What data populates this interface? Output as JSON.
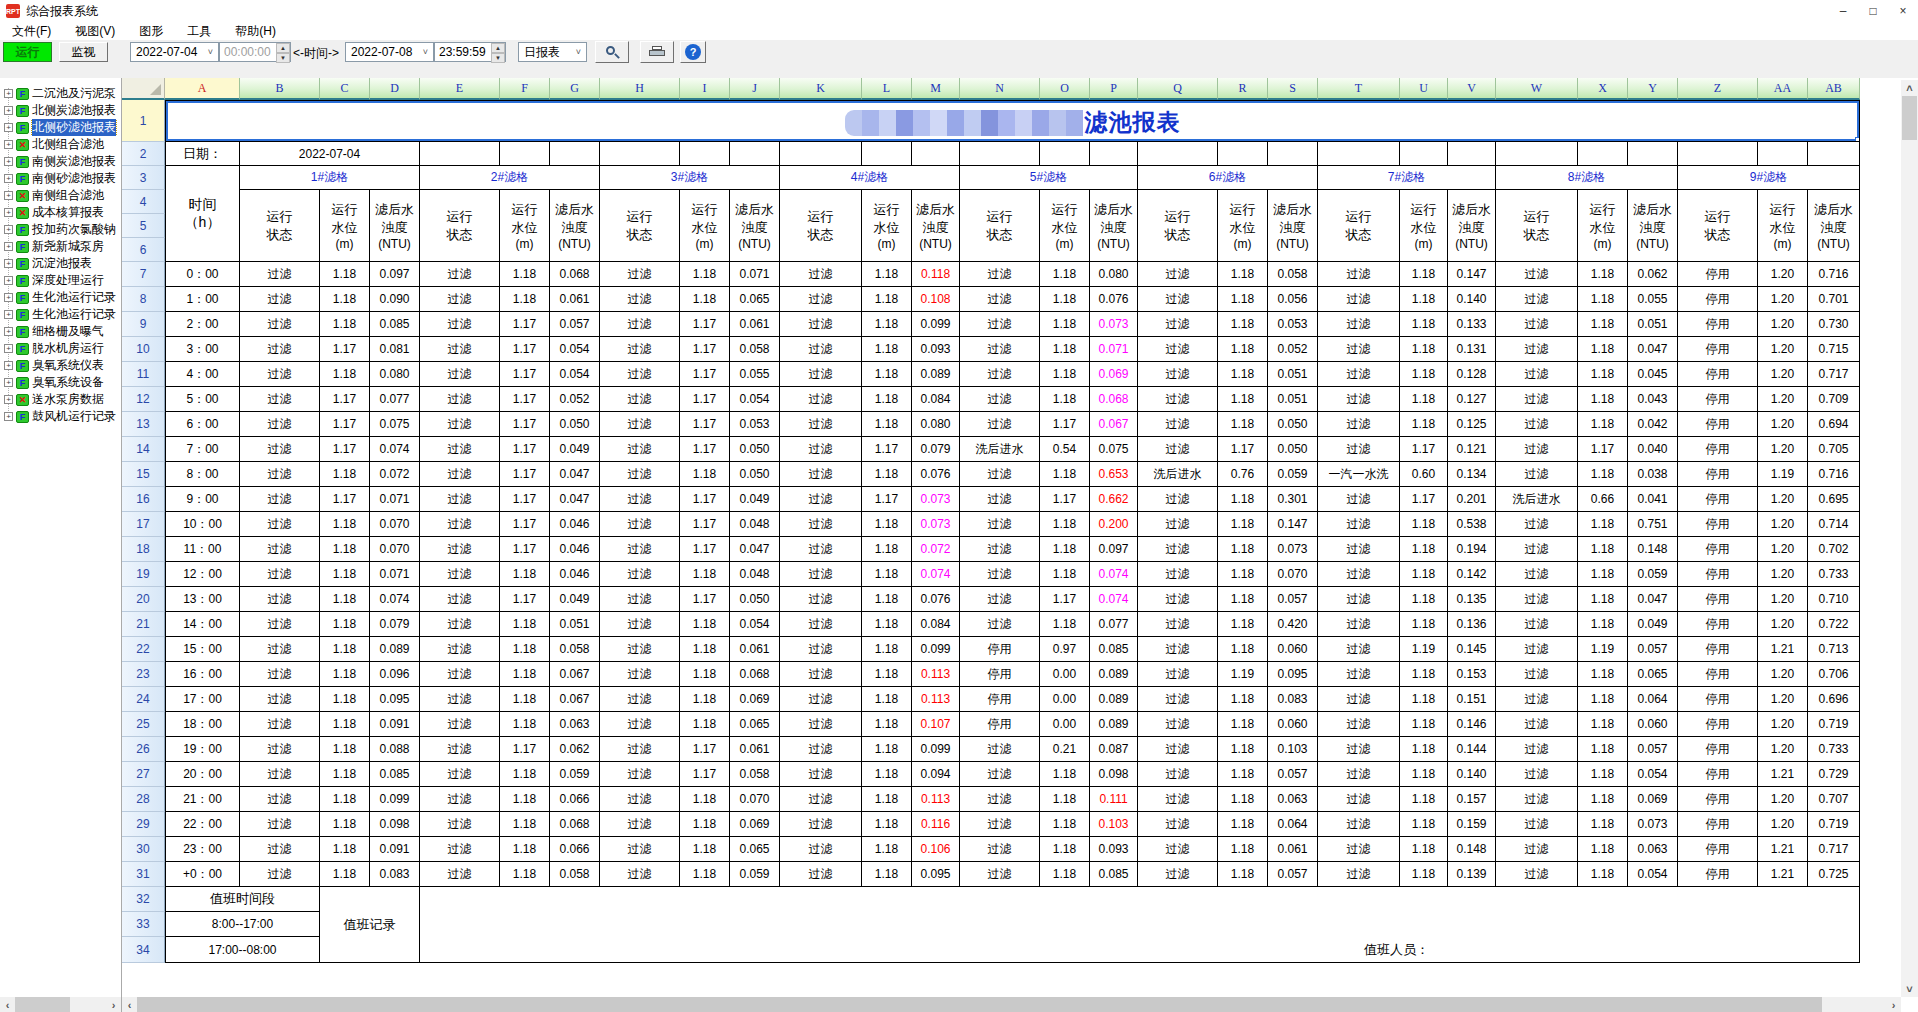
{
  "window": {
    "title": "综合报表系统",
    "minimize": "–",
    "maximize": "□",
    "close": "×"
  },
  "menu": [
    "文件(F)",
    "视图(V)",
    "图形",
    "工具",
    "帮助(H)"
  ],
  "toolbar": {
    "run": "运行",
    "monitor": "监视",
    "date_from": "2022-07-04",
    "time_from": "00:00:00",
    "time_label": "<-时间->",
    "date_to": "2022-07-08",
    "time_to": "23:59:59",
    "report_type": "日报表"
  },
  "sidebar": {
    "items": [
      {
        "label": "二沉池及污泥泵",
        "icon": "f"
      },
      {
        "label": "北侧炭滤池报表",
        "icon": "f"
      },
      {
        "label": "北侧砂滤池报表",
        "icon": "f",
        "selected": true
      },
      {
        "label": "北侧组合滤池",
        "icon": "x"
      },
      {
        "label": "南侧炭滤池报表",
        "icon": "f"
      },
      {
        "label": "南侧砂滤池报表",
        "icon": "f"
      },
      {
        "label": "南侧组合滤池",
        "icon": "x"
      },
      {
        "label": "成本核算报表",
        "icon": "x"
      },
      {
        "label": "投加药次氯酸钠",
        "icon": "f"
      },
      {
        "label": "新尧新城泵房",
        "icon": "f"
      },
      {
        "label": "沉淀池报表",
        "icon": "f"
      },
      {
        "label": "深度处理运行",
        "icon": "f"
      },
      {
        "label": "生化池运行记录",
        "icon": "f"
      },
      {
        "label": "生化池运行记录",
        "icon": "f"
      },
      {
        "label": "细格栅及曝气",
        "icon": "f"
      },
      {
        "label": "脱水机房运行",
        "icon": "f"
      },
      {
        "label": "臭氧系统仪表",
        "icon": "f"
      },
      {
        "label": "臭氧系统设备",
        "icon": "f"
      },
      {
        "label": "送水泵房数据",
        "icon": "x"
      },
      {
        "label": "鼓风机运行记录",
        "icon": "f"
      }
    ]
  },
  "sheet": {
    "columns": [
      "A",
      "B",
      "C",
      "D",
      "E",
      "F",
      "G",
      "H",
      "I",
      "J",
      "K",
      "L",
      "M",
      "N",
      "O",
      "P",
      "Q",
      "R",
      "S",
      "T",
      "U",
      "V",
      "W",
      "X",
      "Y",
      "Z",
      "AA",
      "AB"
    ],
    "title": {
      "censored_colors": [
        "#bcc8f0",
        "#a8b6ec",
        "#c8d2f4",
        "#8a9ae2",
        "#b4c0f0",
        "#d0d8f6",
        "#98a8e8",
        "#c0ccf2",
        "#8494dd",
        "#aab6ef",
        "#c8d0f4",
        "#9aa8e8",
        "#b8c4ee",
        "#a2b0ea"
      ],
      "visible_text": "滤池报表"
    },
    "date_label": "日期：",
    "date_value": "2022-07-04",
    "groups": [
      "1#滤格",
      "2#滤格",
      "3#滤格",
      "4#滤格",
      "5#滤格",
      "6#滤格",
      "7#滤格",
      "8#滤格",
      "9#滤格"
    ],
    "subheaders": {
      "time": "时间",
      "time_unit": "（h）",
      "run": "运行",
      "status": "状态",
      "level": "水位",
      "level_unit": "(m)",
      "filtered": "滤后水",
      "turbidity": "浊度",
      "turbidity_unit": "(NTU)"
    },
    "value_colors": {
      "r": "#ff0000",
      "m": "#ff00ff"
    },
    "rows": [
      {
        "row": 7,
        "time": "0：00",
        "cells": [
          "过滤",
          "1.18",
          "0.097",
          "过滤",
          "1.18",
          "0.068",
          "过滤",
          "1.18",
          "0.071",
          "过滤",
          "1.18",
          "0.118|r",
          "过滤",
          "1.18",
          "0.080",
          "过滤",
          "1.18",
          "0.058",
          "过滤",
          "1.18",
          "0.147",
          "过滤",
          "1.18",
          "0.062",
          "停用",
          "1.20",
          "0.716"
        ]
      },
      {
        "row": 8,
        "time": "1：00",
        "cells": [
          "过滤",
          "1.18",
          "0.090",
          "过滤",
          "1.18",
          "0.061",
          "过滤",
          "1.18",
          "0.065",
          "过滤",
          "1.18",
          "0.108|r",
          "过滤",
          "1.18",
          "0.076",
          "过滤",
          "1.18",
          "0.056",
          "过滤",
          "1.18",
          "0.140",
          "过滤",
          "1.18",
          "0.055",
          "停用",
          "1.20",
          "0.701"
        ]
      },
      {
        "row": 9,
        "time": "2：00",
        "cells": [
          "过滤",
          "1.18",
          "0.085",
          "过滤",
          "1.17",
          "0.057",
          "过滤",
          "1.17",
          "0.061",
          "过滤",
          "1.18",
          "0.099",
          "过滤",
          "1.18",
          "0.073|m",
          "过滤",
          "1.18",
          "0.053",
          "过滤",
          "1.18",
          "0.133",
          "过滤",
          "1.18",
          "0.051",
          "停用",
          "1.20",
          "0.730"
        ]
      },
      {
        "row": 10,
        "time": "3：00",
        "cells": [
          "过滤",
          "1.17",
          "0.081",
          "过滤",
          "1.17",
          "0.054",
          "过滤",
          "1.17",
          "0.058",
          "过滤",
          "1.18",
          "0.093",
          "过滤",
          "1.18",
          "0.071|m",
          "过滤",
          "1.18",
          "0.052",
          "过滤",
          "1.18",
          "0.131",
          "过滤",
          "1.18",
          "0.047",
          "停用",
          "1.20",
          "0.715"
        ]
      },
      {
        "row": 11,
        "time": "4：00",
        "cells": [
          "过滤",
          "1.18",
          "0.080",
          "过滤",
          "1.17",
          "0.054",
          "过滤",
          "1.17",
          "0.055",
          "过滤",
          "1.18",
          "0.089",
          "过滤",
          "1.18",
          "0.069|m",
          "过滤",
          "1.18",
          "0.051",
          "过滤",
          "1.18",
          "0.128",
          "过滤",
          "1.18",
          "0.045",
          "停用",
          "1.20",
          "0.717"
        ]
      },
      {
        "row": 12,
        "time": "5：00",
        "cells": [
          "过滤",
          "1.17",
          "0.077",
          "过滤",
          "1.17",
          "0.052",
          "过滤",
          "1.17",
          "0.054",
          "过滤",
          "1.18",
          "0.084",
          "过滤",
          "1.18",
          "0.068|m",
          "过滤",
          "1.18",
          "0.051",
          "过滤",
          "1.18",
          "0.127",
          "过滤",
          "1.18",
          "0.043",
          "停用",
          "1.20",
          "0.709"
        ]
      },
      {
        "row": 13,
        "time": "6：00",
        "cells": [
          "过滤",
          "1.17",
          "0.075",
          "过滤",
          "1.17",
          "0.050",
          "过滤",
          "1.17",
          "0.053",
          "过滤",
          "1.18",
          "0.080",
          "过滤",
          "1.17",
          "0.067|m",
          "过滤",
          "1.18",
          "0.050",
          "过滤",
          "1.18",
          "0.125",
          "过滤",
          "1.18",
          "0.042",
          "停用",
          "1.20",
          "0.694"
        ]
      },
      {
        "row": 14,
        "time": "7：00",
        "cells": [
          "过滤",
          "1.17",
          "0.074",
          "过滤",
          "1.17",
          "0.049",
          "过滤",
          "1.17",
          "0.050",
          "过滤",
          "1.17",
          "0.079",
          "洗后进水",
          "0.54",
          "0.075",
          "过滤",
          "1.17",
          "0.050",
          "过滤",
          "1.17",
          "0.121",
          "过滤",
          "1.17",
          "0.040",
          "停用",
          "1.20",
          "0.705"
        ]
      },
      {
        "row": 15,
        "time": "8：00",
        "cells": [
          "过滤",
          "1.18",
          "0.072",
          "过滤",
          "1.17",
          "0.047",
          "过滤",
          "1.18",
          "0.050",
          "过滤",
          "1.18",
          "0.076",
          "过滤",
          "1.18",
          "0.653|r",
          "洗后进水",
          "0.76",
          "0.059",
          "一汽一水洗",
          "0.60",
          "0.134",
          "过滤",
          "1.18",
          "0.038",
          "停用",
          "1.19",
          "0.716"
        ]
      },
      {
        "row": 16,
        "time": "9：00",
        "cells": [
          "过滤",
          "1.17",
          "0.071",
          "过滤",
          "1.17",
          "0.047",
          "过滤",
          "1.17",
          "0.049",
          "过滤",
          "1.17",
          "0.073|m",
          "过滤",
          "1.17",
          "0.662|r",
          "过滤",
          "1.18",
          "0.301",
          "过滤",
          "1.17",
          "0.201",
          "洗后进水",
          "0.66",
          "0.041",
          "停用",
          "1.20",
          "0.695"
        ]
      },
      {
        "row": 17,
        "time": "10：00",
        "cells": [
          "过滤",
          "1.18",
          "0.070",
          "过滤",
          "1.17",
          "0.046",
          "过滤",
          "1.17",
          "0.048",
          "过滤",
          "1.18",
          "0.073|m",
          "过滤",
          "1.18",
          "0.200|r",
          "过滤",
          "1.18",
          "0.147",
          "过滤",
          "1.18",
          "0.538",
          "过滤",
          "1.18",
          "0.751",
          "停用",
          "1.20",
          "0.714"
        ]
      },
      {
        "row": 18,
        "time": "11：00",
        "cells": [
          "过滤",
          "1.18",
          "0.070",
          "过滤",
          "1.17",
          "0.046",
          "过滤",
          "1.17",
          "0.047",
          "过滤",
          "1.18",
          "0.072|m",
          "过滤",
          "1.18",
          "0.097",
          "过滤",
          "1.18",
          "0.073",
          "过滤",
          "1.18",
          "0.194",
          "过滤",
          "1.18",
          "0.148",
          "停用",
          "1.20",
          "0.702"
        ]
      },
      {
        "row": 19,
        "time": "12：00",
        "cells": [
          "过滤",
          "1.18",
          "0.071",
          "过滤",
          "1.18",
          "0.046",
          "过滤",
          "1.18",
          "0.048",
          "过滤",
          "1.18",
          "0.074|m",
          "过滤",
          "1.18",
          "0.074|m",
          "过滤",
          "1.18",
          "0.070",
          "过滤",
          "1.18",
          "0.142",
          "过滤",
          "1.18",
          "0.059",
          "停用",
          "1.20",
          "0.733"
        ]
      },
      {
        "row": 20,
        "time": "13：00",
        "cells": [
          "过滤",
          "1.18",
          "0.074",
          "过滤",
          "1.17",
          "0.049",
          "过滤",
          "1.17",
          "0.050",
          "过滤",
          "1.18",
          "0.076",
          "过滤",
          "1.17",
          "0.074|m",
          "过滤",
          "1.18",
          "0.057",
          "过滤",
          "1.18",
          "0.135",
          "过滤",
          "1.18",
          "0.047",
          "停用",
          "1.20",
          "0.710"
        ]
      },
      {
        "row": 21,
        "time": "14：00",
        "cells": [
          "过滤",
          "1.18",
          "0.079",
          "过滤",
          "1.18",
          "0.051",
          "过滤",
          "1.18",
          "0.054",
          "过滤",
          "1.18",
          "0.084",
          "过滤",
          "1.18",
          "0.077",
          "过滤",
          "1.18",
          "0.420",
          "过滤",
          "1.18",
          "0.136",
          "过滤",
          "1.18",
          "0.049",
          "停用",
          "1.20",
          "0.722"
        ]
      },
      {
        "row": 22,
        "time": "15：00",
        "cells": [
          "过滤",
          "1.18",
          "0.089",
          "过滤",
          "1.18",
          "0.058",
          "过滤",
          "1.18",
          "0.061",
          "过滤",
          "1.18",
          "0.099",
          "停用",
          "0.97",
          "0.085",
          "过滤",
          "1.18",
          "0.060",
          "过滤",
          "1.19",
          "0.145",
          "过滤",
          "1.19",
          "0.057",
          "停用",
          "1.21",
          "0.713"
        ]
      },
      {
        "row": 23,
        "time": "16：00",
        "cells": [
          "过滤",
          "1.18",
          "0.096",
          "过滤",
          "1.18",
          "0.067",
          "过滤",
          "1.18",
          "0.068",
          "过滤",
          "1.18",
          "0.113|r",
          "停用",
          "0.00",
          "0.089",
          "过滤",
          "1.19",
          "0.095",
          "过滤",
          "1.18",
          "0.153",
          "过滤",
          "1.18",
          "0.065",
          "停用",
          "1.20",
          "0.706"
        ]
      },
      {
        "row": 24,
        "time": "17：00",
        "cells": [
          "过滤",
          "1.18",
          "0.095",
          "过滤",
          "1.18",
          "0.067",
          "过滤",
          "1.18",
          "0.069",
          "过滤",
          "1.18",
          "0.113|r",
          "停用",
          "0.00",
          "0.089",
          "过滤",
          "1.18",
          "0.083",
          "过滤",
          "1.18",
          "0.151",
          "过滤",
          "1.18",
          "0.064",
          "停用",
          "1.20",
          "0.696"
        ]
      },
      {
        "row": 25,
        "time": "18：00",
        "cells": [
          "过滤",
          "1.18",
          "0.091",
          "过滤",
          "1.18",
          "0.063",
          "过滤",
          "1.18",
          "0.065",
          "过滤",
          "1.18",
          "0.107|r",
          "停用",
          "0.00",
          "0.089",
          "过滤",
          "1.18",
          "0.060",
          "过滤",
          "1.18",
          "0.146",
          "过滤",
          "1.18",
          "0.060",
          "停用",
          "1.20",
          "0.719"
        ]
      },
      {
        "row": 26,
        "time": "19：00",
        "cells": [
          "过滤",
          "1.18",
          "0.088",
          "过滤",
          "1.17",
          "0.062",
          "过滤",
          "1.17",
          "0.061",
          "过滤",
          "1.18",
          "0.099",
          "过滤",
          "0.21",
          "0.087",
          "过滤",
          "1.18",
          "0.103",
          "过滤",
          "1.18",
          "0.144",
          "过滤",
          "1.18",
          "0.057",
          "停用",
          "1.20",
          "0.733"
        ]
      },
      {
        "row": 27,
        "time": "20：00",
        "cells": [
          "过滤",
          "1.18",
          "0.085",
          "过滤",
          "1.18",
          "0.059",
          "过滤",
          "1.17",
          "0.058",
          "过滤",
          "1.18",
          "0.094",
          "过滤",
          "1.18",
          "0.098",
          "过滤",
          "1.18",
          "0.057",
          "过滤",
          "1.18",
          "0.140",
          "过滤",
          "1.18",
          "0.054",
          "停用",
          "1.21",
          "0.729"
        ]
      },
      {
        "row": 28,
        "time": "21：00",
        "cells": [
          "过滤",
          "1.18",
          "0.099",
          "过滤",
          "1.18",
          "0.066",
          "过滤",
          "1.18",
          "0.070",
          "过滤",
          "1.18",
          "0.113|r",
          "过滤",
          "1.18",
          "0.111|r",
          "过滤",
          "1.18",
          "0.063",
          "过滤",
          "1.18",
          "0.157",
          "过滤",
          "1.18",
          "0.069",
          "停用",
          "1.20",
          "0.707"
        ]
      },
      {
        "row": 29,
        "time": "22：00",
        "cells": [
          "过滤",
          "1.18",
          "0.098",
          "过滤",
          "1.18",
          "0.068",
          "过滤",
          "1.18",
          "0.069",
          "过滤",
          "1.18",
          "0.116|r",
          "过滤",
          "1.18",
          "0.103|r",
          "过滤",
          "1.18",
          "0.064",
          "过滤",
          "1.18",
          "0.159",
          "过滤",
          "1.18",
          "0.073",
          "停用",
          "1.20",
          "0.719"
        ]
      },
      {
        "row": 30,
        "time": "23：00",
        "cells": [
          "过滤",
          "1.18",
          "0.091",
          "过滤",
          "1.18",
          "0.066",
          "过滤",
          "1.18",
          "0.065",
          "过滤",
          "1.18",
          "0.106|r",
          "过滤",
          "1.18",
          "0.093",
          "过滤",
          "1.18",
          "0.061",
          "过滤",
          "1.18",
          "0.148",
          "过滤",
          "1.18",
          "0.063",
          "停用",
          "1.21",
          "0.717"
        ]
      },
      {
        "row": 31,
        "time": "+0：00",
        "cells": [
          "过滤",
          "1.18",
          "0.083",
          "过滤",
          "1.18",
          "0.058",
          "过滤",
          "1.18",
          "0.059",
          "过滤",
          "1.18",
          "0.095",
          "过滤",
          "1.18",
          "0.085",
          "过滤",
          "1.18",
          "0.057",
          "过滤",
          "1.18",
          "0.139",
          "过滤",
          "1.18",
          "0.054",
          "停用",
          "1.21",
          "0.725"
        ]
      }
    ],
    "duty": {
      "period": "值班时间段",
      "record": "值班记录",
      "shift_day": "8:00--17:00",
      "shift_night": "17:00--08:00",
      "personnel": "值班人员："
    }
  }
}
